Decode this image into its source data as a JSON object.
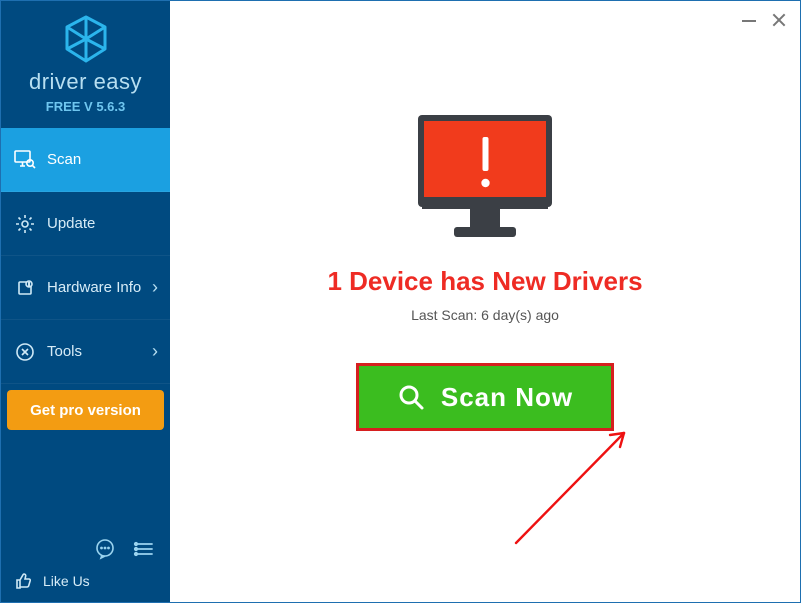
{
  "brand": {
    "name": "driver easy",
    "version_line": "FREE V 5.6.3"
  },
  "sidebar": {
    "items": [
      {
        "label": "Scan"
      },
      {
        "label": "Update"
      },
      {
        "label": "Hardware Info"
      },
      {
        "label": "Tools"
      }
    ],
    "cta": "Get pro version",
    "like_us": "Like Us"
  },
  "main": {
    "headline": "1 Device has New Drivers",
    "last_scan": "Last Scan: 6 day(s) ago",
    "scan_btn": "Scan Now"
  },
  "colors": {
    "sidebar_bg": "#004a80",
    "sidebar_active": "#1ba0e1",
    "accent_orange": "#f39c12",
    "scan_green": "#3bbd1f",
    "alert_red": "#ee2b24"
  }
}
